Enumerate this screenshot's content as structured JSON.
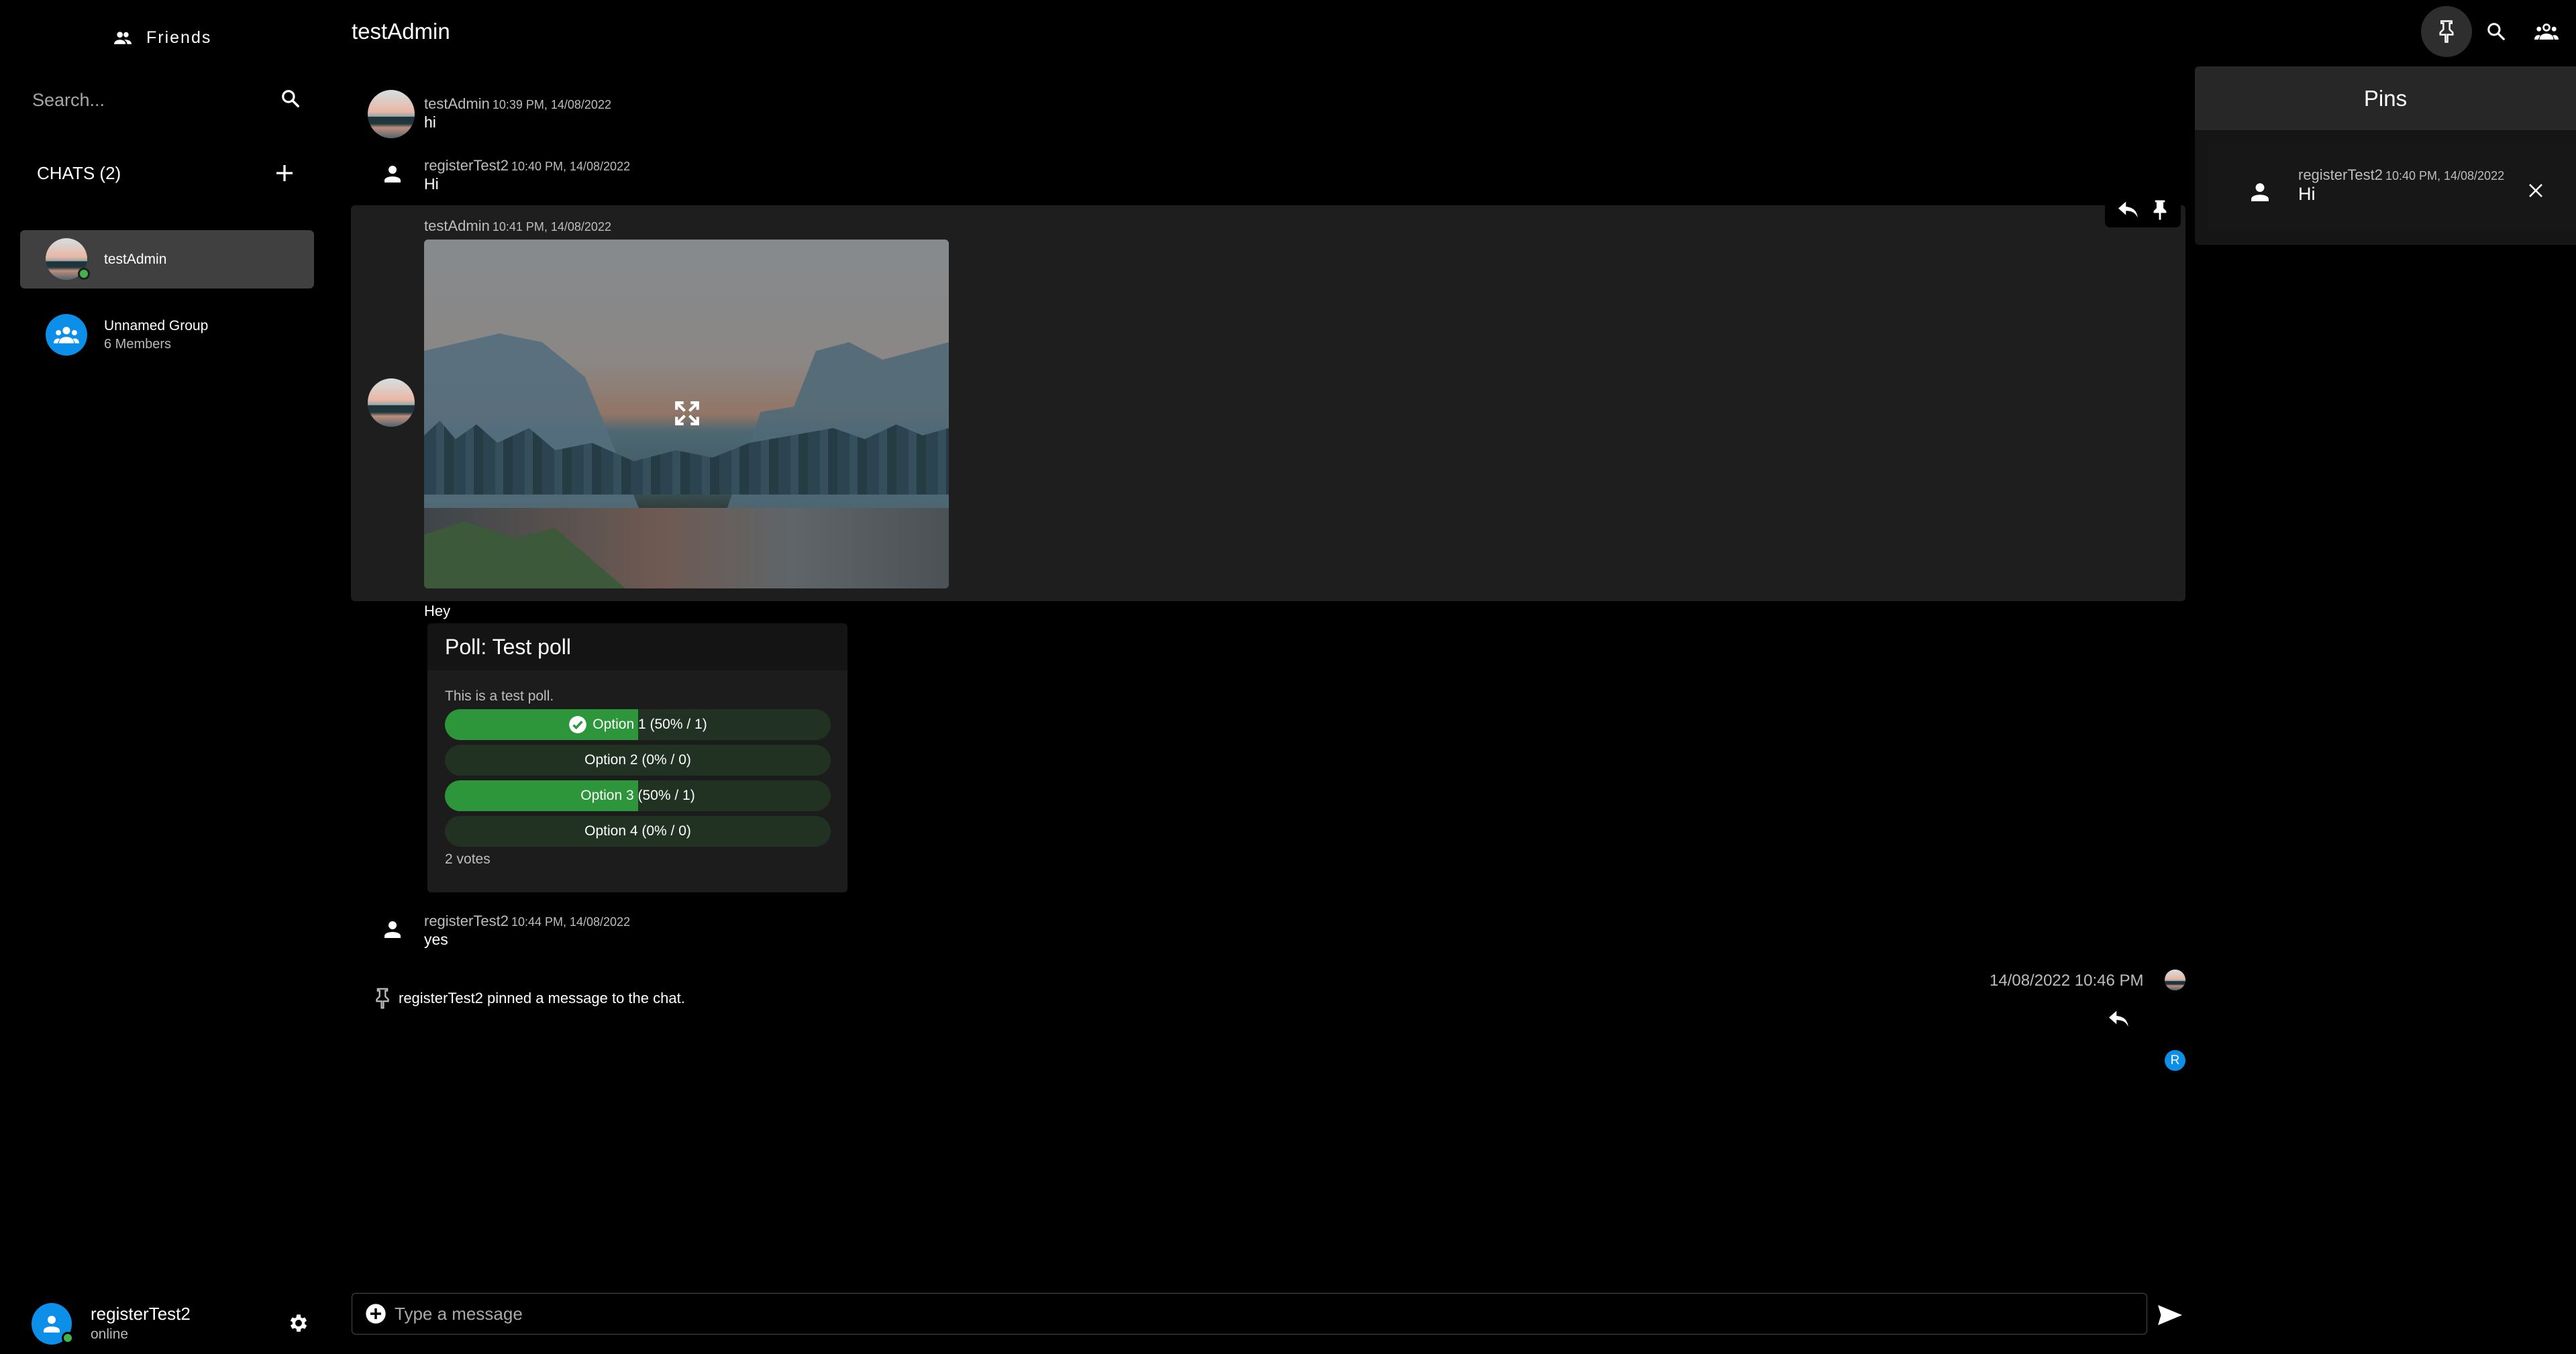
{
  "sidebar": {
    "friends_label": "Friends",
    "search_placeholder": "Search...",
    "chats_label": "CHATS (2)",
    "chats": [
      {
        "name": "testAdmin",
        "active": true,
        "online": true
      },
      {
        "name": "Unnamed Group",
        "subtitle": "6 Members"
      }
    ]
  },
  "header": {
    "title": "testAdmin",
    "icons": [
      "pin-icon",
      "search-icon",
      "group-icon"
    ]
  },
  "messages": [
    {
      "author": "testAdmin",
      "time": "10:39 PM, 14/08/2022",
      "text": "hi",
      "avatar": "landscape"
    },
    {
      "author": "registerTest2",
      "time": "10:40 PM, 14/08/2022",
      "text": "Hi",
      "avatar": "person-icon"
    },
    {
      "author": "testAdmin",
      "time": "10:41 PM, 14/08/2022",
      "attachment": "image",
      "avatar": "landscape",
      "hovered": true
    },
    {
      "text": "Hey"
    },
    {
      "author": "registerTest2",
      "time": "10:44 PM, 14/08/2022",
      "text": "yes",
      "avatar": "person-icon"
    }
  ],
  "poll": {
    "title": "Poll: Test poll",
    "description": "This is a test poll.",
    "options": [
      {
        "label": "Option 1 (50% / 1)",
        "percent": 50,
        "voted": true
      },
      {
        "label": "Option 2 (0% / 0)",
        "percent": 0,
        "voted": false
      },
      {
        "label": "Option 3 (50% / 1)",
        "percent": 50,
        "voted": false
      },
      {
        "label": "Option 4 (0% / 0)",
        "percent": 0,
        "voted": false
      }
    ],
    "votes_label": "2 votes"
  },
  "system_message": "registerTest2 pinned a message to the chat.",
  "read_receipt": {
    "timestamp": "14/08/2022 10:46 PM",
    "badge_letter": "R"
  },
  "pins": {
    "title": "Pins",
    "items": [
      {
        "author": "registerTest2",
        "time": "10:40 PM, 14/08/2022",
        "text": "Hi"
      }
    ]
  },
  "current_user": {
    "name": "registerTest2",
    "status": "online"
  },
  "composer": {
    "placeholder": "Type a message"
  },
  "colors": {
    "accent_blue": "#0b8fe8",
    "online_green": "#44b34a",
    "poll_fill": "#2e963a",
    "poll_track": "#213222"
  }
}
